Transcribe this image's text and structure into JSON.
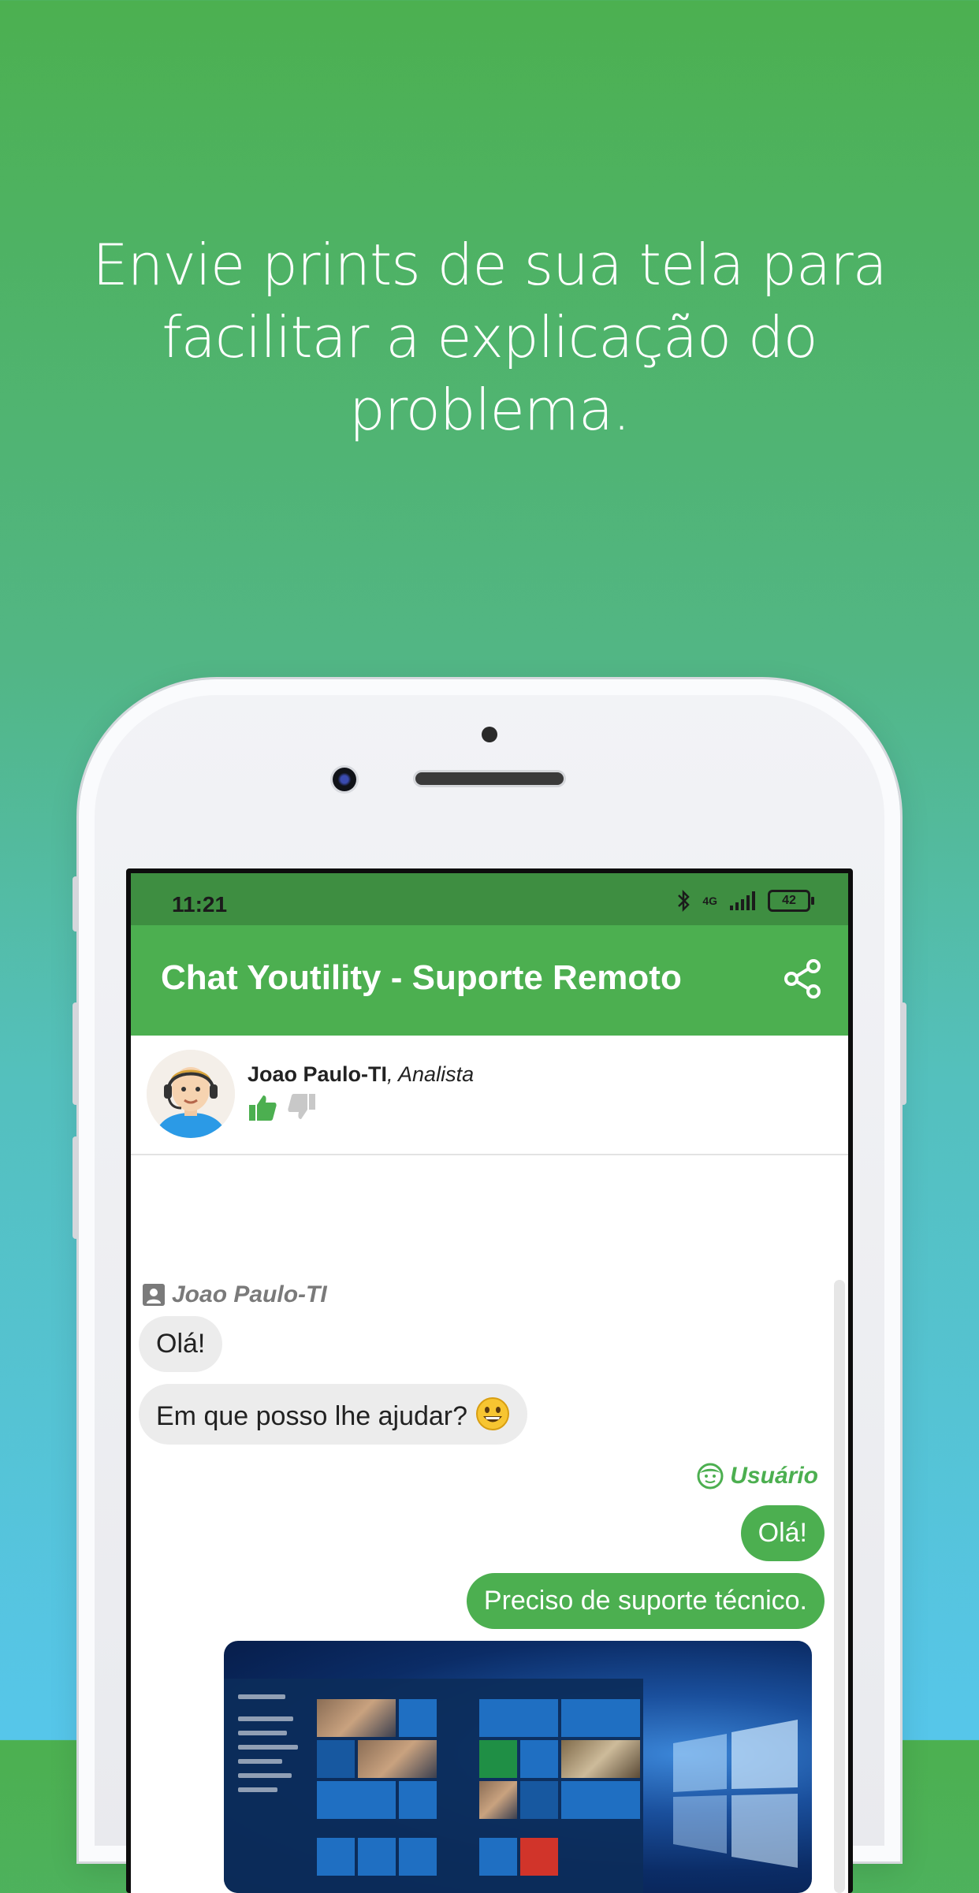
{
  "headline": "Envie prints de sua tela para facilitar a explicação do problema.",
  "status_bar": {
    "time": "11:21",
    "network": "4G",
    "battery": "42"
  },
  "app_bar": {
    "title": "Chat Youtility - Suporte Remoto",
    "share_icon": "share-icon"
  },
  "agent": {
    "name": "Joao Paulo-TI",
    "role": ", Analista",
    "like_icon": "thumbs-up-icon",
    "dislike_icon": "thumbs-down-icon"
  },
  "chat": {
    "agent_sender": "Joao Paulo-TI",
    "user_sender": "Usuário",
    "messages_agent": [
      "Olá!",
      "Em que posso lhe ajudar?"
    ],
    "messages_user": [
      "Olá!",
      "Preciso de suporte técnico."
    ],
    "emoji": "grinning-face-emoji",
    "attachment": "windows-start-menu-screenshot"
  },
  "colors": {
    "brand_green": "#4caf50",
    "status_green": "#3e8e41",
    "bubble_gray": "#ececec"
  }
}
